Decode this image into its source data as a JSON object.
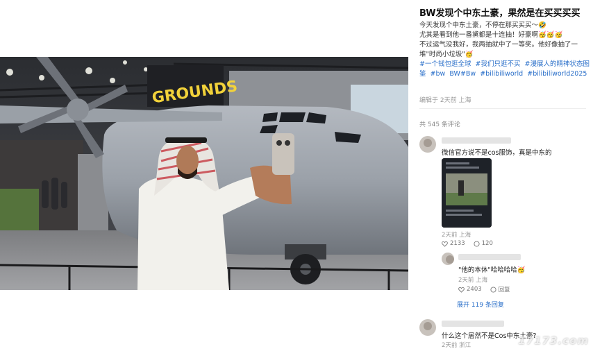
{
  "post": {
    "title": "BW发现个中东土豪，果然是在买买买买",
    "body": [
      "今天发现个中东土豪，不停在那买买买～🤣",
      "尤其是看到他一番黛都是十连抽！好豪啊🥳🥳🥳",
      "不过运气没我好，我两抽就中了一等奖。他好像抽了一",
      "堆\"时尚小垃圾\"🥳"
    ],
    "tags": [
      "#一个钱包逛全球",
      "#我们只逛不买",
      "#漫展人的精神状态图鉴",
      "#bw",
      "BW#Bw",
      "#bilibiliworld",
      "#bilibiliworld2025"
    ],
    "meta": "编辑于 2天前 上海"
  },
  "comments_count": "共 545 条评论",
  "comments": [
    {
      "text": "微信官方说不是cos服饰，真是中东的",
      "meta": "2天前 上海",
      "likes": "2133",
      "replies": "120"
    },
    {
      "text": "\"他的本体\"哈哈哈哈🥳",
      "meta": "2天前 上海",
      "likes": "2403",
      "reply_label": "回复",
      "expand": "展开 119 条回复"
    },
    {
      "text": "什么这个居然不是Cos中东土豪?",
      "meta": "2天前 浙江"
    }
  ],
  "photo": {
    "sign_text": "GROUNDS"
  },
  "watermark": "17173.com",
  "colors": {
    "link": "#2a6fc9",
    "muted": "#999999"
  }
}
